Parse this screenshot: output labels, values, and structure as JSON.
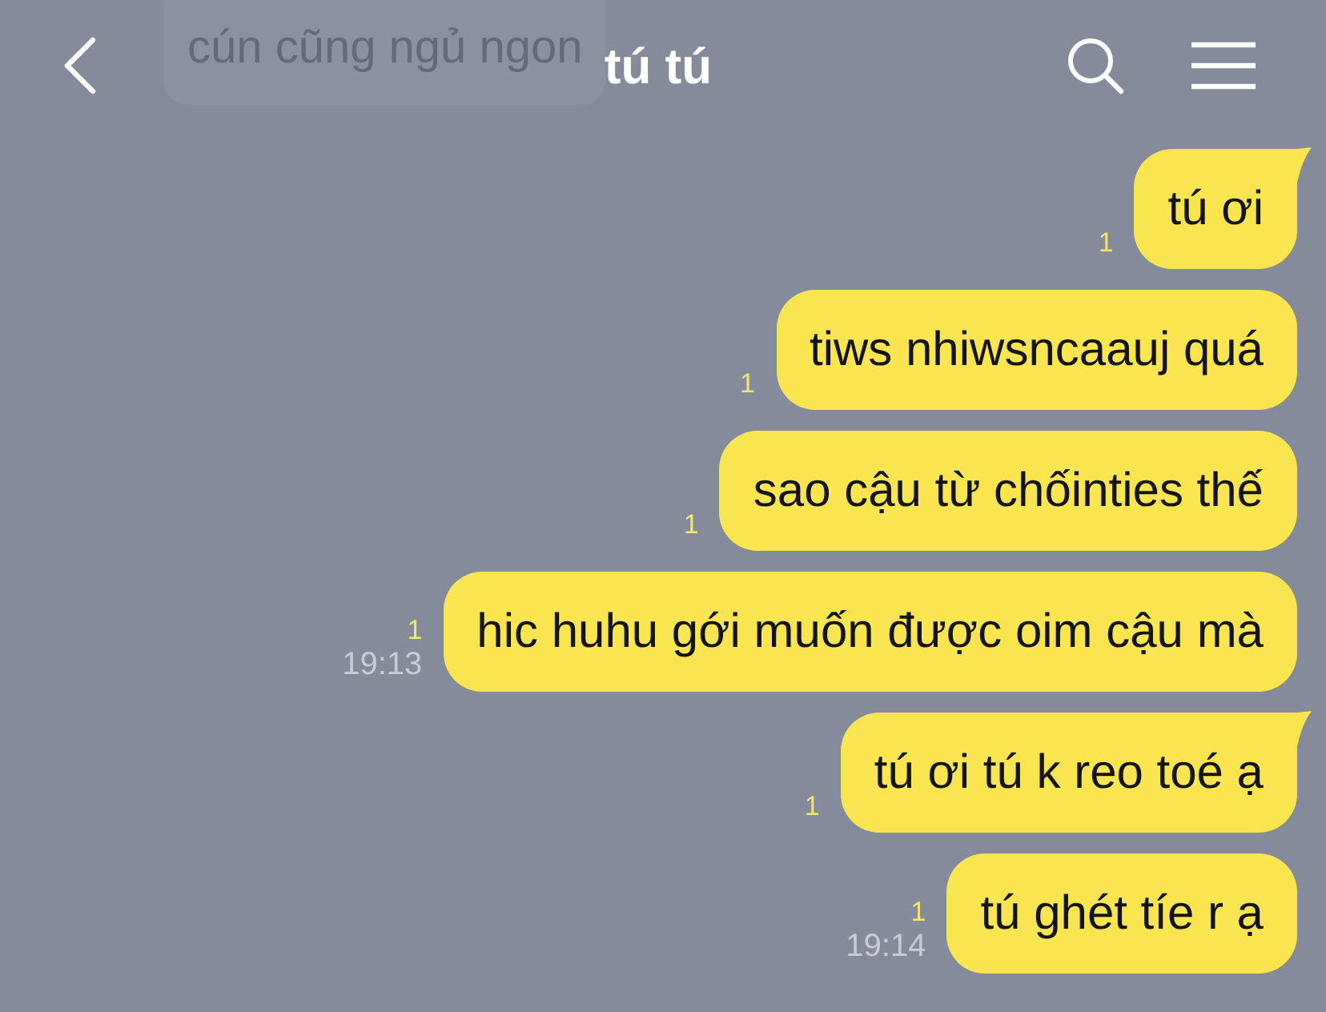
{
  "header": {
    "title": "tú tú"
  },
  "overlay_preview": {
    "text": "cún cũng ngủ ngon"
  },
  "messages": [
    {
      "text": "tú ơi",
      "read": "1",
      "tail": true
    },
    {
      "text": "tiws nhiwsncaauj quá",
      "read": "1",
      "tail": false
    },
    {
      "text": "sao cậu từ chốinties thế",
      "read": "1",
      "tail": false
    },
    {
      "text": "hic huhu gới muốn được oim cậu mà",
      "read": "1",
      "time": "19:13",
      "tail": false
    },
    {
      "text": "tú ơi tú k reo toé ạ",
      "read": "1",
      "tail": true
    },
    {
      "text": "tú ghét tíe r ạ",
      "read": "1",
      "time": "19:14",
      "tail": false
    }
  ]
}
